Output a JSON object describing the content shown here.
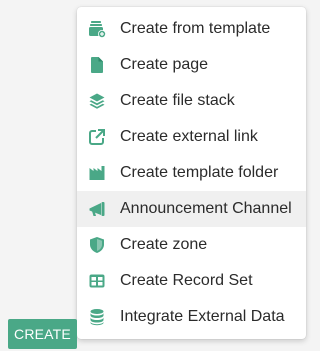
{
  "colors": {
    "icon": "#4aa887",
    "button_bg": "#4aa887",
    "button_text": "#ffffff",
    "menu_text": "#2b2b2b",
    "hover_bg": "#f0f0f0"
  },
  "menu": {
    "items": [
      {
        "label": "Create from template",
        "icon": "template-stack-plus-icon"
      },
      {
        "label": "Create page",
        "icon": "file-icon"
      },
      {
        "label": "Create file stack",
        "icon": "layers-icon"
      },
      {
        "label": "Create external link",
        "icon": "external-link-icon"
      },
      {
        "label": "Create template folder",
        "icon": "template-folder-icon"
      },
      {
        "label": "Announcement Channel",
        "icon": "megaphone-icon",
        "hovered": true
      },
      {
        "label": "Create zone",
        "icon": "shield-icon"
      },
      {
        "label": "Create Record Set",
        "icon": "table-icon"
      },
      {
        "label": "Integrate External Data",
        "icon": "database-icon"
      }
    ]
  },
  "toolbar": {
    "create_label": "CREATE"
  }
}
